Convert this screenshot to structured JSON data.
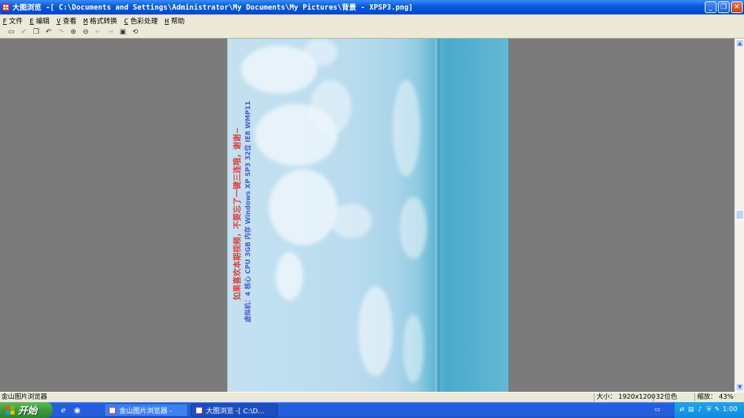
{
  "window": {
    "title": "大图浏览 -[ C:\\Documents and Settings\\Administrator\\My Documents\\My Pictures\\背景 - XPSP3.png]",
    "minimize": "_",
    "maximize": "❐",
    "close": "✕"
  },
  "menu": [
    {
      "key": "F",
      "label": "文件"
    },
    {
      "key": "E",
      "label": "编辑"
    },
    {
      "key": "V",
      "label": "查看"
    },
    {
      "key": "M",
      "label": "格式转换"
    },
    {
      "key": "C",
      "label": "色彩处理"
    },
    {
      "key": "H",
      "label": "帮助"
    }
  ],
  "toolbar": {
    "icons": [
      "select",
      "check",
      "copy",
      "undo",
      "redo",
      "zoom-in",
      "zoom-out",
      "prev",
      "next",
      "fit",
      "rotate"
    ]
  },
  "photo": {
    "line1": "如果喜欢本期视频，不要忘了一键三连哦，谢谢~",
    "line2": "虚拟机：4 核心 CPU   3GB 内存   Windows XP SP3 32位   IE8   WMP11"
  },
  "statusbar": {
    "app_name": "金山图片浏览器",
    "size_label": "大小：",
    "size_value": "1920x1200",
    "color_depth": "32位色",
    "zoom_label": "缩放：",
    "zoom_value": "43%"
  },
  "taskbar": {
    "start_label": "开始",
    "tasks": [
      {
        "label": "金山图片浏览器 -"
      },
      {
        "label": "大图浏览 -[ C:\\D..."
      }
    ],
    "clock": "1:00"
  },
  "colors": {
    "titlebar": "#0a5ce0",
    "taskbar": "#245edb",
    "start": "#3c9a3c",
    "canvas": "#7b7b7b",
    "caption_red": "#e23b3b",
    "caption_blue": "#4c5bd0"
  }
}
